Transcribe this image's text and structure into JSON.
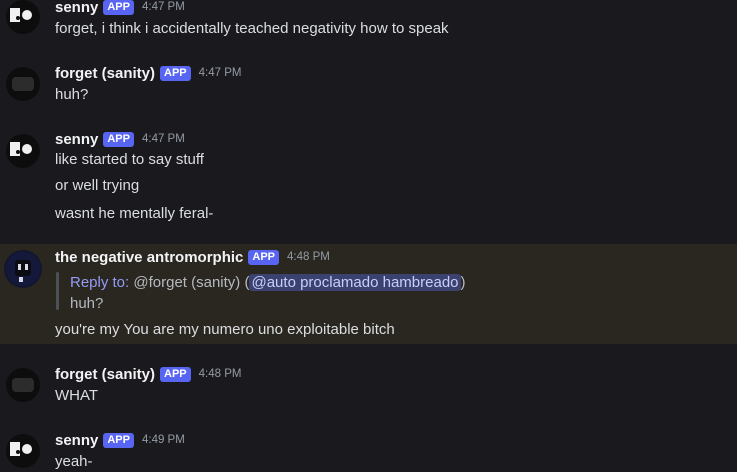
{
  "messages": [
    {
      "author": "senny",
      "badge": "APP",
      "time": "4:47 PM",
      "lines": [
        "forget, i think i accidentally teached negativity how to speak"
      ]
    },
    {
      "author": "forget (sanity)",
      "badge": "APP",
      "time": "4:47 PM",
      "lines": [
        "huh?"
      ]
    },
    {
      "author": "senny",
      "badge": "APP",
      "time": "4:47 PM",
      "lines": [
        "like started to say stuff",
        "or well trying",
        "wasnt he mentally feral-"
      ]
    },
    {
      "author": "the negative antromorphic",
      "badge": "APP",
      "time": "4:48 PM",
      "reply": {
        "label": "Reply to:",
        "user": "@forget (sanity)",
        "open": "(",
        "mention": "@auto proclamado hambreado",
        "close": ")",
        "quote": "huh?"
      },
      "lines": [
        "you're my You are my numero uno exploitable bitch"
      ]
    },
    {
      "author": "forget (sanity)",
      "badge": "APP",
      "time": "4:48 PM",
      "lines": [
        "WHAT"
      ]
    },
    {
      "author": "senny",
      "badge": "APP",
      "time": "4:49 PM",
      "lines": [
        "yeah-"
      ]
    }
  ],
  "colors": {
    "background": "#1a1a1e",
    "highlight": "#2a2620",
    "badge": "#5865f2",
    "mention": "#3c4270"
  },
  "icons": [
    "skull-avatar-icon",
    "negative-avatar-icon"
  ]
}
